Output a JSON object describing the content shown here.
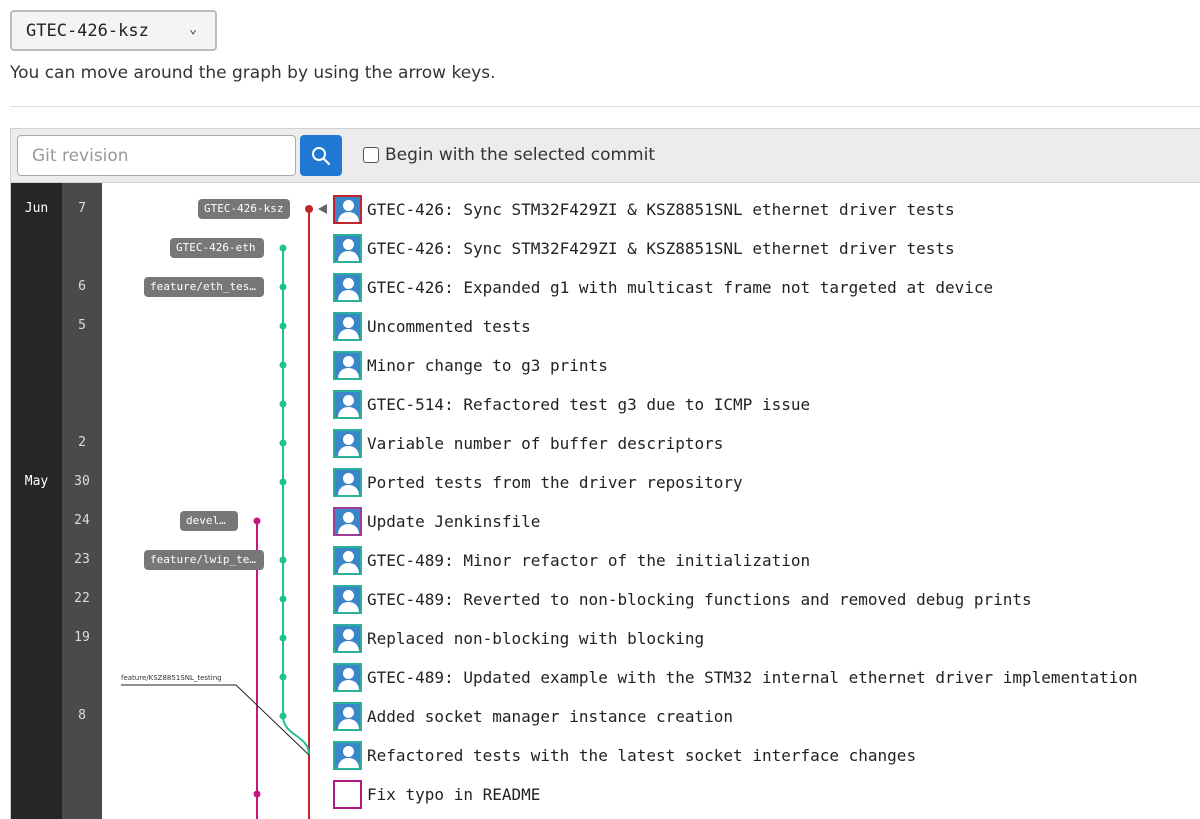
{
  "branch_selector": {
    "value": "GTEC-426-ksz"
  },
  "hint": "You can move around the graph by using the arrow keys.",
  "toolbar": {
    "revision_placeholder": "Git revision",
    "begin_label": "Begin with the selected commit"
  },
  "months": [
    {
      "label": "Jun",
      "row": 0
    },
    {
      "label": "May",
      "row": 7
    }
  ],
  "days": [
    {
      "label": "7",
      "row": 0
    },
    {
      "label": "6",
      "row": 2
    },
    {
      "label": "5",
      "row": 3
    },
    {
      "label": "2",
      "row": 6
    },
    {
      "label": "30",
      "row": 7
    },
    {
      "label": "24",
      "row": 8
    },
    {
      "label": "23",
      "row": 9
    },
    {
      "label": "22",
      "row": 10
    },
    {
      "label": "19",
      "row": 11
    },
    {
      "label": "8",
      "row": 13
    }
  ],
  "refs": [
    {
      "label": "GTEC-426-ksz",
      "row": 0
    },
    {
      "label": "GTEC-426-eth",
      "row": 1
    },
    {
      "label": "feature/eth_tes…",
      "row": 2
    },
    {
      "label": "develop",
      "row": 8
    },
    {
      "label": "feature/lwip_te…",
      "row": 9
    }
  ],
  "small_ref": {
    "label": "feature/KSZ8851SNL_testing"
  },
  "commits": [
    {
      "message": "GTEC-426: Sync STM32F429ZI & KSZ8851SNL ethernet driver tests",
      "avatar": "red"
    },
    {
      "message": "GTEC-426: Sync STM32F429ZI & KSZ8851SNL ethernet driver tests",
      "avatar": "teal"
    },
    {
      "message": "GTEC-426: Expanded g1 with multicast frame not targeted at device",
      "avatar": "teal"
    },
    {
      "message": "Uncommented tests",
      "avatar": "teal"
    },
    {
      "message": "Minor change to g3 prints",
      "avatar": "teal"
    },
    {
      "message": "GTEC-514: Refactored test g3 due to ICMP issue",
      "avatar": "teal"
    },
    {
      "message": "Variable number of buffer descriptors",
      "avatar": "teal"
    },
    {
      "message": "Ported tests from the driver repository",
      "avatar": "teal"
    },
    {
      "message": "Update Jenkinsfile",
      "avatar": "purple"
    },
    {
      "message": "GTEC-489: Minor refactor of the initialization",
      "avatar": "teal"
    },
    {
      "message": "GTEC-489: Reverted to non-blocking functions and removed debug prints",
      "avatar": "teal"
    },
    {
      "message": "Replaced non-blocking with blocking",
      "avatar": "teal"
    },
    {
      "message": "GTEC-489: Updated example with the STM32 internal ethernet driver implementation",
      "avatar": "teal"
    },
    {
      "message": "Added socket manager instance creation",
      "avatar": "teal"
    },
    {
      "message": "Refactored tests with the latest socket interface changes",
      "avatar": "teal"
    },
    {
      "message": "Fix typo in README",
      "avatar": "empty"
    }
  ],
  "colors": {
    "red": "#c0262b",
    "green": "#1ec28b",
    "magenta": "#c4177f",
    "accent": "#1f78d1"
  }
}
